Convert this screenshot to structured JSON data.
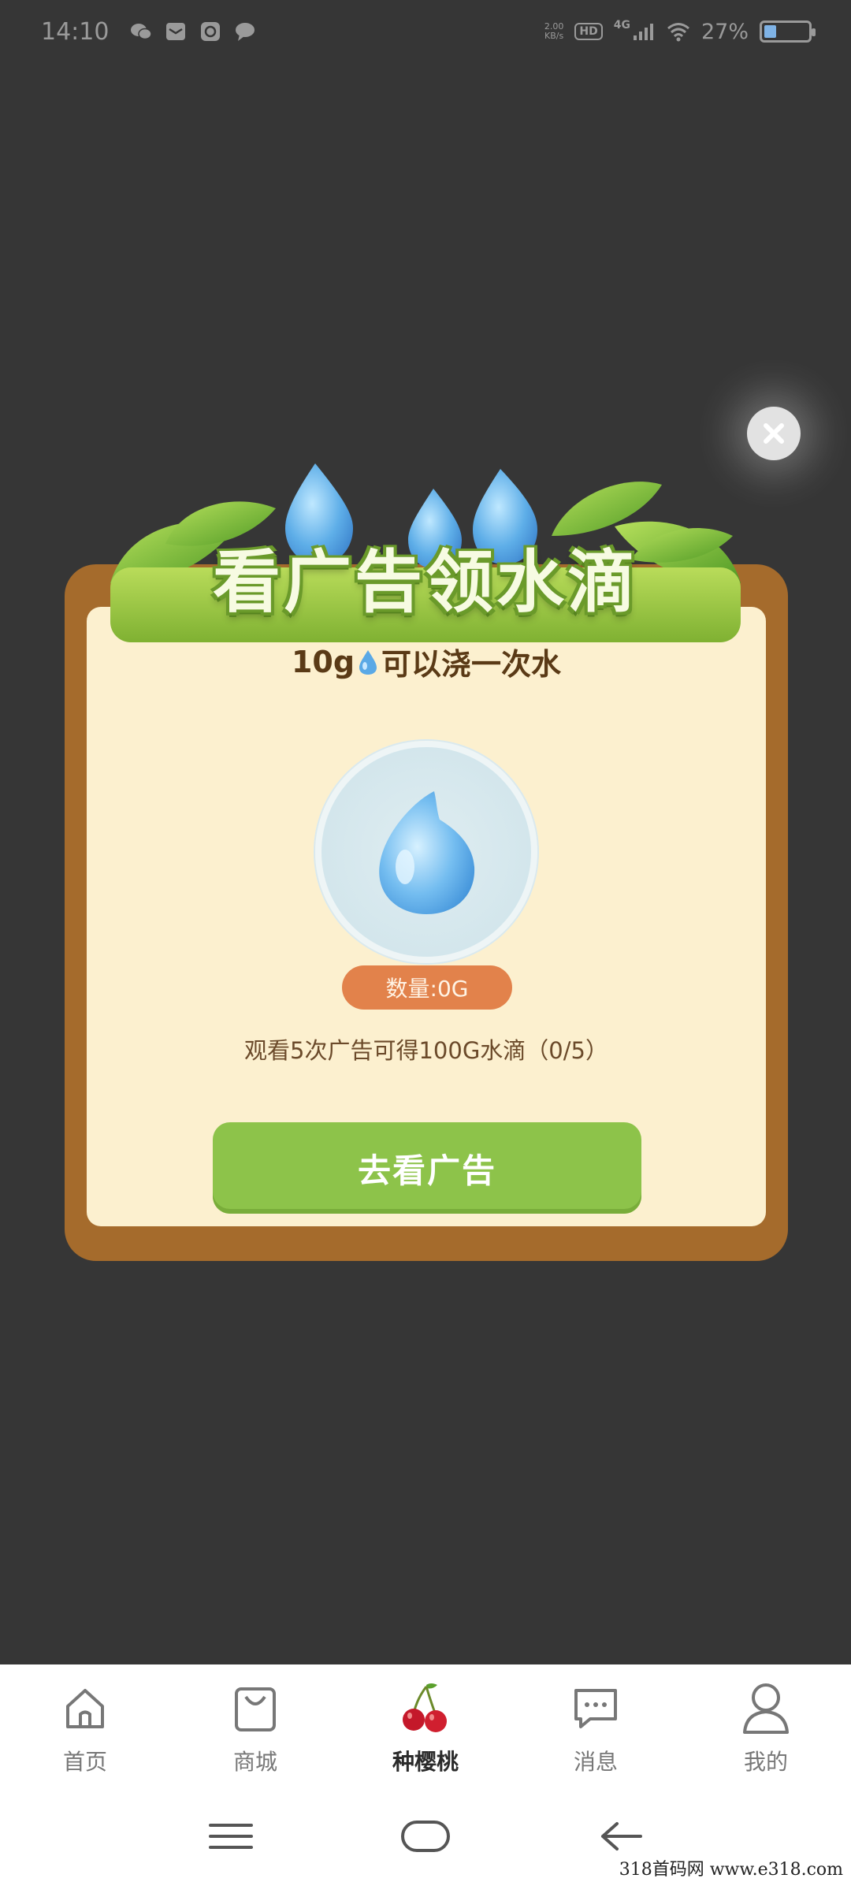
{
  "status_bar": {
    "time": "14:10",
    "speed_value": "2.00",
    "speed_unit": "KB/s",
    "hd_label": "HD",
    "network": "4G",
    "battery_percent": "27%",
    "battery_level": 0.27,
    "notification_icons": [
      "wechat-icon",
      "mail-icon",
      "camera-app-icon",
      "chat-icon"
    ]
  },
  "dialog": {
    "title": "看广告领水滴",
    "subtitle_amount": "10g",
    "subtitle_text": "可以浇一次水",
    "amount_label": "数量:0G",
    "hint": "观看5次广告可得100G水滴（0/5）",
    "watch_button": "去看广告"
  },
  "tabs": [
    {
      "label": "首页",
      "icon": "home-icon",
      "active": false
    },
    {
      "label": "商城",
      "icon": "shopping-bag-icon",
      "active": false
    },
    {
      "label": "种樱桃",
      "icon": "cherry-icon",
      "active": true
    },
    {
      "label": "消息",
      "icon": "message-icon",
      "active": false
    },
    {
      "label": "我的",
      "icon": "profile-icon",
      "active": false
    }
  ],
  "watermark": "318首码网  www.e318.com",
  "colors": {
    "background": "#363636",
    "frame": "#a56b2c",
    "panel": "#fcf0cf",
    "pill": "#e2824b",
    "button": "#8dc34a",
    "title_outline": "#6a9a2a"
  }
}
